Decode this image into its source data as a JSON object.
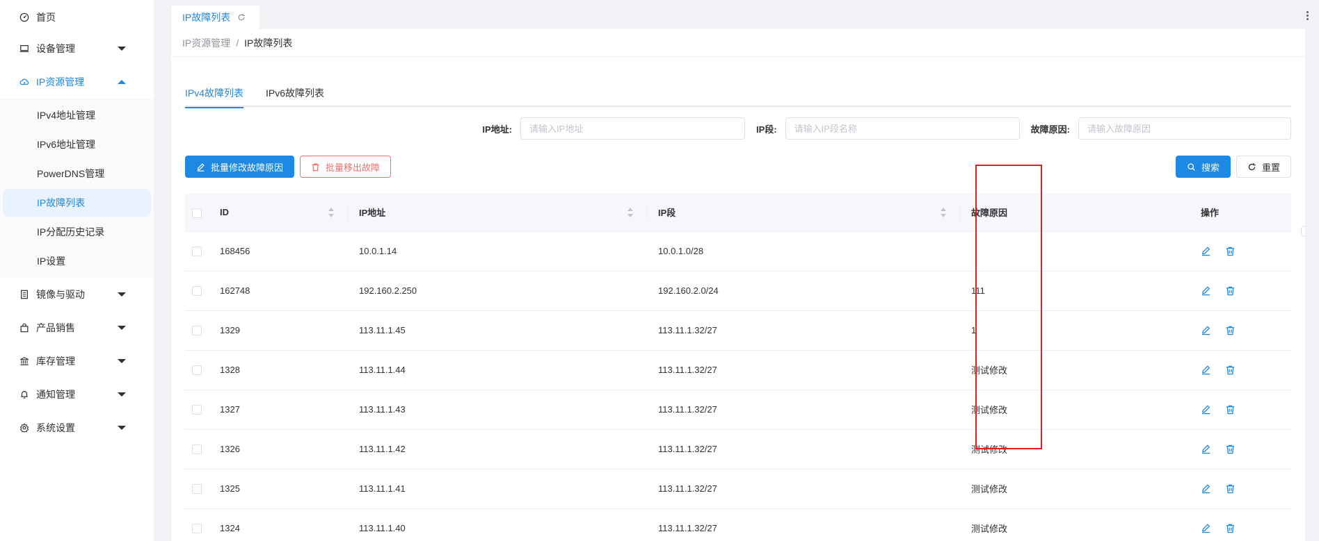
{
  "sidebar": {
    "home": "首页",
    "device": "设备管理",
    "ipres": "IP资源管理",
    "sub": [
      "IPv4地址管理",
      "IPv6地址管理",
      "PowerDNS管理",
      "IP故障列表",
      "IP分配历史记录",
      "IP设置"
    ],
    "image": "镜像与驱动",
    "product": "产品销售",
    "stock": "库存管理",
    "notice": "通知管理",
    "system": "系统设置"
  },
  "page_tab": {
    "label": "IP故障列表"
  },
  "breadcrumb": {
    "parent": "IP资源管理",
    "sep": "/",
    "current": "IP故障列表"
  },
  "sub_tabs": {
    "ipv4": "IPv4故障列表",
    "ipv6": "IPv6故障列表"
  },
  "filters": {
    "ip_label": "IP地址:",
    "ip_placeholder": "请输入IP地址",
    "seg_label": "IP段:",
    "seg_placeholder": "请输入IP段名称",
    "reason_label": "故障原因:",
    "reason_placeholder": "请输入故障原因"
  },
  "actions": {
    "batch_edit": "批量修改故障原因",
    "batch_remove": "批量移出故障",
    "search": "搜索",
    "reset": "重置"
  },
  "table": {
    "headers": {
      "id": "ID",
      "ip": "IP地址",
      "seg": "IP段",
      "reason": "故障原因",
      "op": "操作"
    },
    "rows": [
      {
        "id": "168456",
        "ip": "10.0.1.14",
        "seg": "10.0.1.0/28",
        "reason": ""
      },
      {
        "id": "162748",
        "ip": "192.160.2.250",
        "seg": "192.160.2.0/24",
        "reason": "111"
      },
      {
        "id": "1329",
        "ip": "113.11.1.45",
        "seg": "113.11.1.32/27",
        "reason": "1"
      },
      {
        "id": "1328",
        "ip": "113.11.1.44",
        "seg": "113.11.1.32/27",
        "reason": "测试修改"
      },
      {
        "id": "1327",
        "ip": "113.11.1.43",
        "seg": "113.11.1.32/27",
        "reason": "测试修改"
      },
      {
        "id": "1326",
        "ip": "113.11.1.42",
        "seg": "113.11.1.32/27",
        "reason": "测试修改"
      },
      {
        "id": "1325",
        "ip": "113.11.1.41",
        "seg": "113.11.1.32/27",
        "reason": "测试修改"
      },
      {
        "id": "1324",
        "ip": "113.11.1.40",
        "seg": "113.11.1.32/27",
        "reason": "测试修改"
      }
    ]
  },
  "colors": {
    "primary": "#1e88e5",
    "danger": "#f56c6c",
    "highlight": "#e02020"
  }
}
